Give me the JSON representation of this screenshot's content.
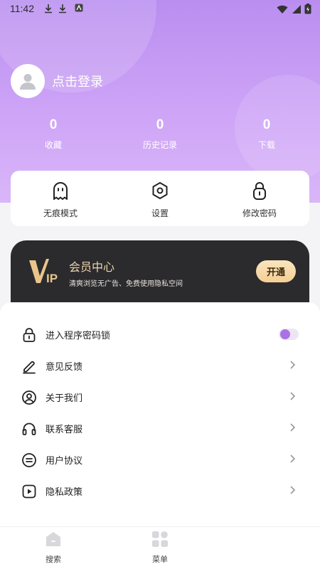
{
  "status_bar": {
    "time": "11:42"
  },
  "profile": {
    "login_label": "点击登录"
  },
  "stats": [
    {
      "value": "0",
      "label": "收藏"
    },
    {
      "value": "0",
      "label": "历史记录"
    },
    {
      "value": "0",
      "label": "下载"
    }
  ],
  "quick_actions": [
    {
      "label": "无痕模式",
      "icon": "ghost-icon"
    },
    {
      "label": "设置",
      "icon": "gear-hexagon-icon"
    },
    {
      "label": "修改密码",
      "icon": "lock-icon"
    }
  ],
  "vip": {
    "logo_text": "VIP",
    "title": "会员中心",
    "subtitle": "清爽浏览无广告、免费使用隐私空间",
    "button_label": "开通"
  },
  "settings": [
    {
      "label": "进入程序密码锁",
      "icon": "lock-icon",
      "control": "toggle",
      "toggle_on": false
    },
    {
      "label": "意见反馈",
      "icon": "pen-icon",
      "control": "chevron"
    },
    {
      "label": "关于我们",
      "icon": "user-circle-icon",
      "control": "chevron"
    },
    {
      "label": "联系客服",
      "icon": "headset-icon",
      "control": "chevron"
    },
    {
      "label": "用户协议",
      "icon": "document-circle-icon",
      "control": "chevron"
    },
    {
      "label": "隐私政策",
      "icon": "play-square-icon",
      "control": "chevron"
    }
  ],
  "bottom_nav": [
    {
      "label": "搜索",
      "icon": "home-icon"
    },
    {
      "label": "菜单",
      "icon": "grid-icon"
    }
  ],
  "colors": {
    "header_gradient_top": "#b98ef0",
    "accent_purple": "#a973e6",
    "vip_card": "#2b2b2e",
    "vip_gold": "#f0d5a8"
  }
}
